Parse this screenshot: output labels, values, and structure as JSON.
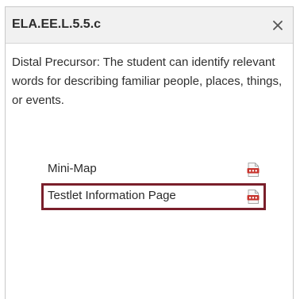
{
  "dialog": {
    "title": "ELA.EE.L.5.5.c",
    "close_icon": "close-icon",
    "description": "Distal Precursor: The student can identify relevant words for describing familiar people, places, things, or events."
  },
  "resources": [
    {
      "label": "Mini-Map",
      "icon": "pdf-icon",
      "selected": false
    },
    {
      "label": "Testlet Information Page",
      "icon": "pdf-icon",
      "selected": true
    }
  ],
  "colors": {
    "selection_border": "#7a1f2b",
    "header_background": "#f1f1f1",
    "pdf_icon": "#c7332c"
  }
}
